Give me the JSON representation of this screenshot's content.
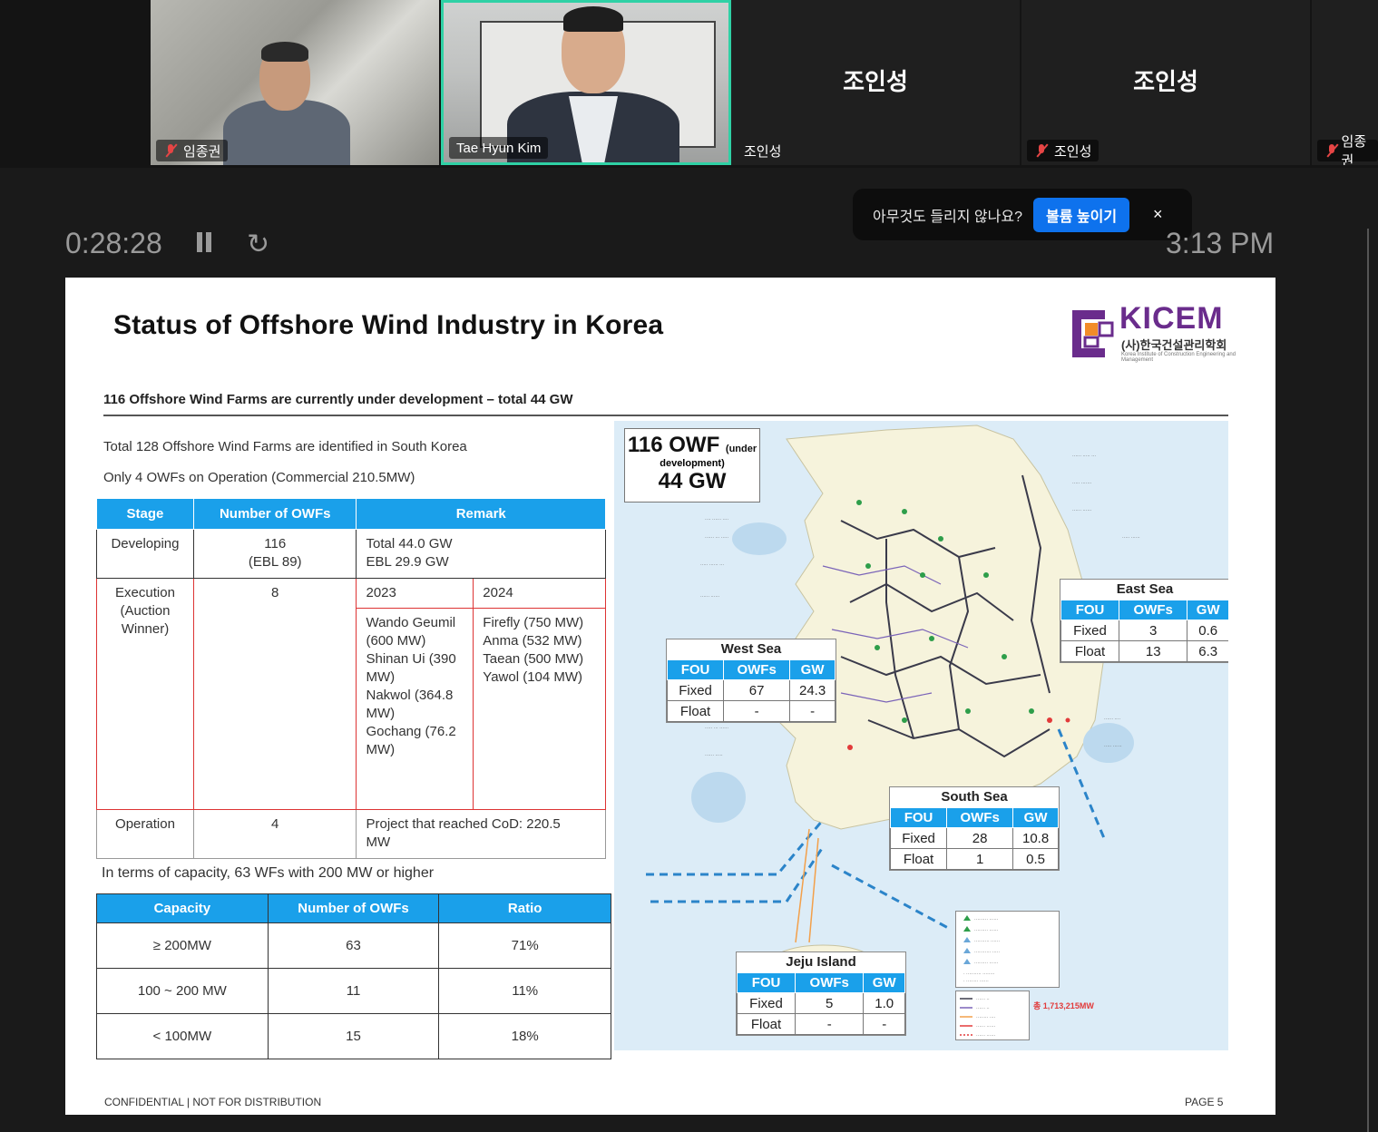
{
  "participants": [
    {
      "name": "임종권",
      "muted": true,
      "has_video": true
    },
    {
      "name": "Tae Hyun Kim",
      "muted": false,
      "has_video": true,
      "active_speaker": true
    },
    {
      "name": "조인성",
      "big_name": "조인성",
      "muted": false,
      "has_video": false
    },
    {
      "name": "조인성",
      "big_name": "조인성",
      "muted": true,
      "has_video": false
    },
    {
      "name": "임종권",
      "muted": true,
      "has_video": false
    }
  ],
  "toast": {
    "message": "아무것도 들리지 않나요?",
    "button": "볼륨 높이기",
    "close": "×"
  },
  "recording": {
    "elapsed": "0:28:28",
    "clock": "3:13 PM",
    "refresh_icon": "↻"
  },
  "slide": {
    "title": "Status of Offshore Wind Industry in Korea",
    "logo": {
      "name": "KICEM",
      "korean": "(사)한국건설관리학회",
      "english": "Korea Institute of Construction Engineering and Management"
    },
    "subtitle": "116 Offshore Wind Farms are currently under development – total 44 GW",
    "line1": "Total 128 Offshore Wind Farms are identified in South Korea",
    "line2": "Only 4 OWFs on Operation (Commercial 210.5MW)",
    "stage_table": {
      "headers": [
        "Stage",
        "Number  of OWFs",
        "Remark"
      ],
      "developing": {
        "stage": "Developing",
        "count": "116",
        "count_note": "(EBL 89)",
        "remark1": "Total 44.0 GW",
        "remark2": "EBL 29.9 GW"
      },
      "execution": {
        "stage1": "Execution",
        "stage2": "(Auction",
        "stage3": "Winner)",
        "count": "8",
        "year_a": "2023",
        "year_b": "2024",
        "list_a": [
          "Wando Geumil",
          "(600 MW)",
          "Shinan Ui (390",
          "MW)",
          "Nakwol (364.8",
          "MW)",
          "Gochang (76.2",
          "MW)"
        ],
        "list_b": [
          "Firefly (750 MW)",
          "Anma (532 MW)",
          "Taean (500 MW)",
          "Yawol (104 MW)"
        ]
      },
      "operation": {
        "stage": "Operation",
        "count": "4",
        "remark1": "Project that reached CoD: 220.5",
        "remark2": "MW"
      }
    },
    "capacity_note": "In terms of capacity, 63 WFs with 200 MW or higher",
    "capacity_table": {
      "headers": [
        "Capacity",
        "Number of OWFs",
        "Ratio"
      ],
      "rows": [
        [
          "≥ 200MW",
          "63",
          "71%"
        ],
        [
          "100 ~ 200 MW",
          "11",
          "11%"
        ],
        [
          "< 100MW",
          "15",
          "18%"
        ]
      ]
    },
    "map": {
      "owf_big": "116 OWF",
      "owf_small1": "(under",
      "owf_small2": "development)",
      "owf_gw": "44 GW",
      "sea_headers": [
        "FOU",
        "OWFs",
        "GW"
      ],
      "west_sea": {
        "title": "West Sea",
        "rows": [
          [
            "Fixed",
            "67",
            "24.3"
          ],
          [
            "Float",
            "-",
            "-"
          ]
        ]
      },
      "east_sea": {
        "title": "East Sea",
        "rows": [
          [
            "Fixed",
            "3",
            "0.6"
          ],
          [
            "Float",
            "13",
            "6.3"
          ]
        ]
      },
      "south_sea": {
        "title": "South Sea",
        "rows": [
          [
            "Fixed",
            "28",
            "10.8"
          ],
          [
            "Float",
            "1",
            "0.5"
          ]
        ]
      },
      "jeju": {
        "title": "Jeju Island",
        "rows": [
          [
            "Fixed",
            "5",
            "1.0"
          ],
          [
            "Float",
            "-",
            "-"
          ]
        ]
      },
      "total_note": "총 1,713,215MW"
    },
    "footer_left": "CONFIDENTIAL  |  NOT FOR DISTRIBUTION",
    "footer_right": "PAGE 5"
  },
  "colors": {
    "accent": "#1aa0ea",
    "speaker_border": "#2fd1a5",
    "mute": "#e64545",
    "toast_button": "#0e72ed",
    "logo": "#6a2c8c"
  }
}
